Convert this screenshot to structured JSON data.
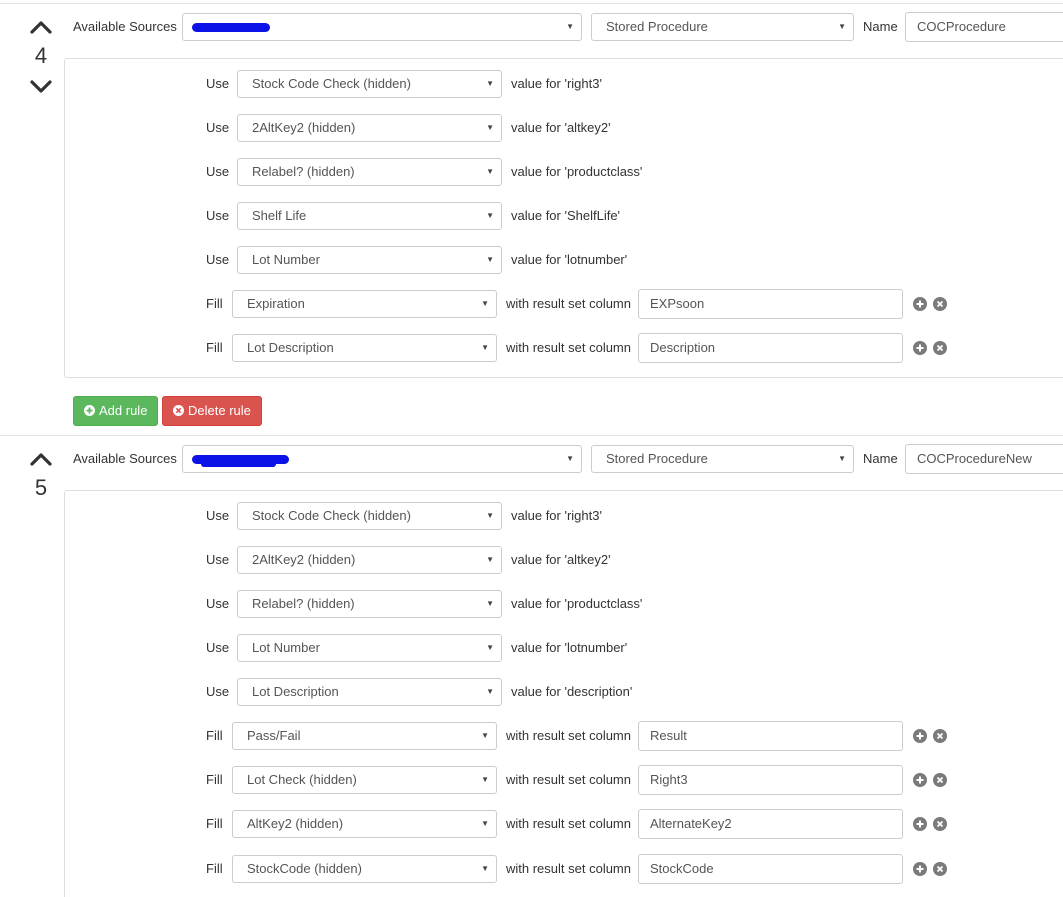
{
  "labels": {
    "available_sources": "Available Sources",
    "name": "Name",
    "use": "Use",
    "fill": "Fill",
    "result_column": "with result set column"
  },
  "colors": {
    "add_button": "#5cb85c",
    "delete_button": "#d9534f",
    "redaction": "#0a12e8",
    "icon_grey": "#7a7a7a"
  },
  "buttons": {
    "add_rule": "Add rule",
    "delete_rule": "Delete rule"
  },
  "sections": [
    {
      "number": "4",
      "source_value": "",
      "type_value": "Stored Procedure",
      "name_value": "COCProcedure",
      "uses": [
        {
          "field": "Stock Code Check (hidden)",
          "value_text": "value for 'right3'"
        },
        {
          "field": "2AltKey2 (hidden)",
          "value_text": "value for 'altkey2'"
        },
        {
          "field": "Relabel? (hidden)",
          "value_text": "value for 'productclass'"
        },
        {
          "field": "Shelf Life",
          "value_text": "value for 'ShelfLife'"
        },
        {
          "field": "Lot Number",
          "value_text": "value for 'lotnumber'"
        }
      ],
      "fills": [
        {
          "field": "Expiration",
          "column": "EXPsoon"
        },
        {
          "field": "Lot Description",
          "column": "Description"
        }
      ]
    },
    {
      "number": "5",
      "source_value": "",
      "type_value": "Stored Procedure",
      "name_value": "COCProcedureNew",
      "uses": [
        {
          "field": "Stock Code Check (hidden)",
          "value_text": "value for 'right3'"
        },
        {
          "field": "2AltKey2 (hidden)",
          "value_text": "value for 'altkey2'"
        },
        {
          "field": "Relabel? (hidden)",
          "value_text": "value for 'productclass'"
        },
        {
          "field": "Lot Number",
          "value_text": "value for 'lotnumber'"
        },
        {
          "field": "Lot Description",
          "value_text": "value for 'description'"
        }
      ],
      "fills": [
        {
          "field": "Pass/Fail",
          "column": "Result"
        },
        {
          "field": "Lot Check (hidden)",
          "column": "Right3"
        },
        {
          "field": "AltKey2 (hidden)",
          "column": "AlternateKey2"
        },
        {
          "field": "StockCode (hidden)",
          "column": "StockCode"
        }
      ]
    }
  ]
}
